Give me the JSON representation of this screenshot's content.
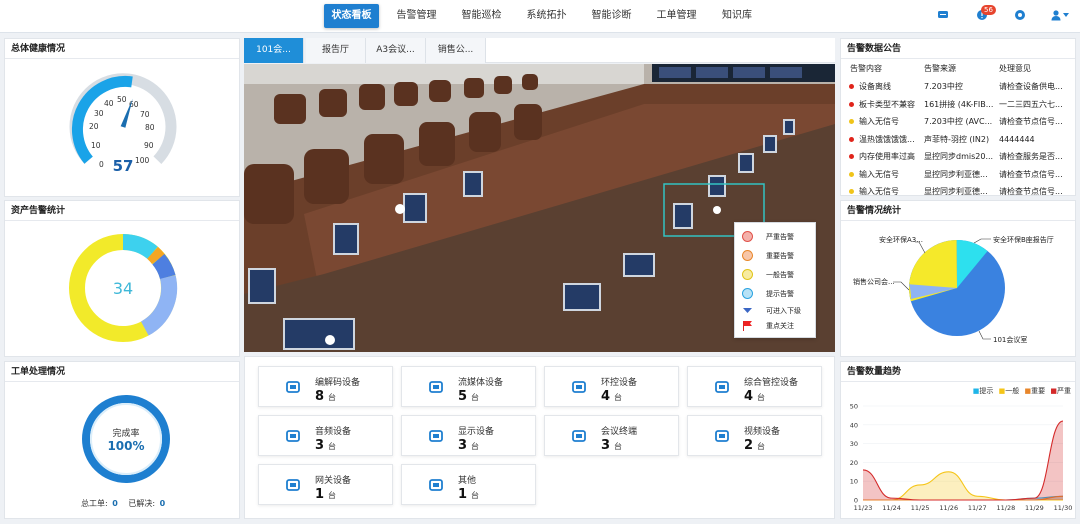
{
  "nav": {
    "items": [
      "状态看板",
      "告警管理",
      "智能巡检",
      "系统拓扑",
      "智能诊断",
      "工单管理",
      "知识库"
    ],
    "badge": "56"
  },
  "health": {
    "title": "总体健康情况",
    "value": "57",
    "ticks": [
      "0",
      "10",
      "20",
      "30",
      "40",
      "50",
      "60",
      "70",
      "80",
      "90",
      "100"
    ],
    "score": 57
  },
  "asset": {
    "title": "资产告警统计",
    "total": "34"
  },
  "work": {
    "title": "工单处理情况",
    "rate_label": "完成率",
    "rate": "100%",
    "total_label": "总工单:",
    "total": "0",
    "solved_label": "已解决:",
    "solved": "0",
    "progress": 1.0
  },
  "tabs": [
    "101会...",
    "报告厅",
    "A3会议...",
    "销售公..."
  ],
  "legend": [
    "严重告警",
    "重要告警",
    "一般告警",
    "提示告警",
    "可进入下级",
    "重点关注"
  ],
  "devices": [
    {
      "name": "编解码设备",
      "count": "8",
      "unit": "台",
      "icon": "codec-icon"
    },
    {
      "name": "流媒体设备",
      "count": "5",
      "unit": "台",
      "icon": "stream-icon"
    },
    {
      "name": "环控设备",
      "count": "4",
      "unit": "台",
      "icon": "env-control-icon"
    },
    {
      "name": "综合管控设备",
      "count": "4",
      "unit": "台",
      "icon": "control-icon"
    },
    {
      "name": "音频设备",
      "count": "3",
      "unit": "台",
      "icon": "audio-icon"
    },
    {
      "name": "显示设备",
      "count": "3",
      "unit": "台",
      "icon": "display-icon"
    },
    {
      "name": "会议终端",
      "count": "3",
      "unit": "台",
      "icon": "phone-icon"
    },
    {
      "name": "视频设备",
      "count": "2",
      "unit": "台",
      "icon": "video-icon"
    },
    {
      "name": "网关设备",
      "count": "1",
      "unit": "台",
      "icon": "gateway-icon"
    },
    {
      "name": "其他",
      "count": "1",
      "unit": "台",
      "icon": "other-icon"
    }
  ],
  "announce": {
    "title": "告警数据公告",
    "headers": [
      "告警内容",
      "告警来源",
      "处理意见"
    ],
    "rows": [
      {
        "content": "设备离线",
        "source": "7.203中控",
        "advice": "请检查设备供电...",
        "color": "#e0241b"
      },
      {
        "content": "板卡类型不兼容",
        "source": "161拼接 (4K-FIB...",
        "advice": "一二三四五六七...",
        "color": "#e0241b"
      },
      {
        "content": "输入无信号",
        "source": "7.203中控 (AVC...",
        "advice": "请检查节点信号...",
        "color": "#f0c419"
      },
      {
        "content": "温热饿饿饿饿...",
        "source": "声菲特-羽控 (IN2)",
        "advice": "4444444",
        "color": "#e0241b"
      },
      {
        "content": "内存使用率过高",
        "source": "显控同步dmis20...",
        "advice": "请检查服务是否...",
        "color": "#e0241b"
      },
      {
        "content": "输入无信号",
        "source": "显控同步利亚德...",
        "advice": "请检查节点信号...",
        "color": "#f0c419"
      },
      {
        "content": "输入无信号",
        "source": "显控同步利亚德...",
        "advice": "请检查节点信号...",
        "color": "#f0c419"
      }
    ]
  },
  "pie": {
    "title": "告警情况统计",
    "labels": [
      "安全环保A3...",
      "安全环保B座报告厅",
      "销售公司会...",
      "101会议室"
    ]
  },
  "trend": {
    "title": "告警数量趋势",
    "legend": [
      "提示",
      "一般",
      "重要",
      "严重"
    ]
  },
  "chart_data": {
    "type": "area",
    "title": "告警数量趋势",
    "x": [
      "11/23",
      "11/24",
      "11/25",
      "11/26",
      "11/27",
      "11/28",
      "11/29",
      "11/30"
    ],
    "ylim": [
      0,
      50
    ],
    "yticks": [
      0,
      10,
      20,
      30,
      40,
      50
    ],
    "series": [
      {
        "name": "提示",
        "color": "#1fb5e8",
        "values": [
          0,
          0,
          0,
          0,
          0,
          0,
          1,
          2
        ]
      },
      {
        "name": "一般",
        "color": "#f5c518",
        "values": [
          0,
          0,
          8,
          15,
          2,
          0,
          0,
          0
        ]
      },
      {
        "name": "重要",
        "color": "#e8862a",
        "values": [
          0,
          0,
          0,
          0,
          0,
          0,
          0,
          2
        ]
      },
      {
        "name": "严重",
        "color": "#d42a2a",
        "values": [
          16,
          1,
          0,
          0,
          0,
          0,
          1,
          42
        ]
      }
    ]
  }
}
